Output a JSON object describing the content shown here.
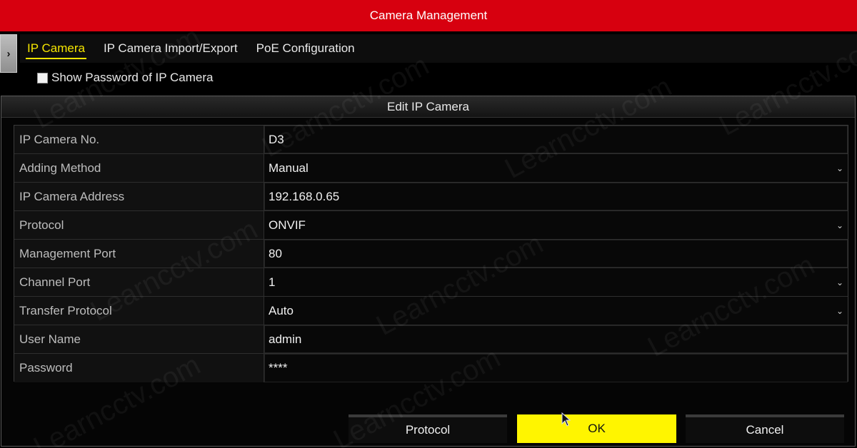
{
  "window": {
    "title": "Camera Management"
  },
  "tabs": [
    {
      "label": "IP Camera",
      "active": true
    },
    {
      "label": "IP Camera Import/Export",
      "active": false
    },
    {
      "label": "PoE Configuration",
      "active": false
    }
  ],
  "show_password": {
    "label": "Show Password of IP Camera",
    "checked": false
  },
  "dialog": {
    "title": "Edit IP Camera",
    "fields": [
      {
        "label": "IP Camera No.",
        "value": "D3",
        "type": "text"
      },
      {
        "label": "Adding Method",
        "value": "Manual",
        "type": "select"
      },
      {
        "label": "IP Camera Address",
        "value": "192.168.0.65",
        "type": "text"
      },
      {
        "label": "Protocol",
        "value": "ONVIF",
        "type": "select"
      },
      {
        "label": "Management Port",
        "value": "80",
        "type": "text"
      },
      {
        "label": "Channel Port",
        "value": "1",
        "type": "select"
      },
      {
        "label": "Transfer Protocol",
        "value": "Auto",
        "type": "select"
      },
      {
        "label": "User Name",
        "value": "admin",
        "type": "text"
      },
      {
        "label": "Password",
        "value": "****",
        "type": "text"
      }
    ],
    "buttons": {
      "protocol": "Protocol",
      "ok": "OK",
      "cancel": "Cancel"
    }
  },
  "watermark": "Learncctv.com",
  "colors": {
    "title_bar": "#d7000f",
    "accent": "#f6e600",
    "ok_button": "#fff500"
  }
}
